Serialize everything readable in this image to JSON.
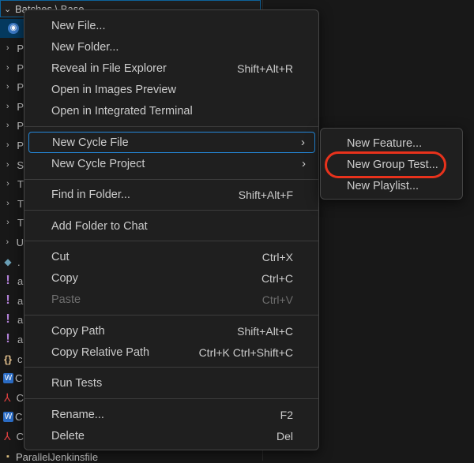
{
  "explorer": {
    "header_title": "Batches \\ Base",
    "tree_rows": [
      {
        "glyph": "›",
        "kind": "chev",
        "letter": "P"
      },
      {
        "glyph": "›",
        "kind": "chev",
        "letter": "P"
      },
      {
        "glyph": "›",
        "kind": "chev",
        "letter": "P"
      },
      {
        "glyph": "›",
        "kind": "chev",
        "letter": "P"
      },
      {
        "glyph": "›",
        "kind": "chev",
        "letter": "P"
      },
      {
        "glyph": "›",
        "kind": "chev",
        "letter": "P"
      },
      {
        "glyph": "›",
        "kind": "chev",
        "letter": "S"
      },
      {
        "glyph": "›",
        "kind": "chev",
        "letter": "T"
      },
      {
        "glyph": "›",
        "kind": "chev",
        "letter": "T"
      },
      {
        "glyph": "›",
        "kind": "chev",
        "letter": "T"
      },
      {
        "glyph": "›",
        "kind": "chev",
        "letter": "U"
      },
      {
        "glyph": "◆",
        "kind": "diamond",
        "letter": "."
      },
      {
        "glyph": "!",
        "kind": "excl",
        "letter": "a"
      },
      {
        "glyph": "!",
        "kind": "excl",
        "letter": "a"
      },
      {
        "glyph": "!",
        "kind": "excl",
        "letter": "a"
      },
      {
        "glyph": "!",
        "kind": "excl",
        "letter": "a"
      },
      {
        "glyph": "{}",
        "kind": "brace",
        "letter": "c"
      },
      {
        "glyph": "W",
        "kind": "word",
        "letter": "C"
      },
      {
        "glyph": "⅄",
        "kind": "pdf",
        "letter": "C"
      },
      {
        "glyph": "W",
        "kind": "word",
        "letter": "C"
      },
      {
        "glyph": "⅄",
        "kind": "pdf",
        "letter": "C"
      }
    ],
    "footer_label": "ParallelJenkinsfile"
  },
  "context_menu": {
    "items": [
      {
        "id": "new-file",
        "label": "New File...",
        "shortcut": ""
      },
      {
        "id": "new-folder",
        "label": "New Folder...",
        "shortcut": ""
      },
      {
        "id": "reveal",
        "label": "Reveal in File Explorer",
        "shortcut": "Shift+Alt+R"
      },
      {
        "id": "open-images-preview",
        "label": "Open in Images Preview",
        "shortcut": ""
      },
      {
        "id": "open-terminal",
        "label": "Open in Integrated Terminal",
        "shortcut": ""
      },
      {
        "id": "new-cycle-file",
        "label": "New Cycle File",
        "shortcut": "",
        "submenu": true
      },
      {
        "id": "new-cycle-project",
        "label": "New Cycle Project",
        "shortcut": "",
        "submenu": true
      },
      {
        "id": "find-in-folder",
        "label": "Find in Folder...",
        "shortcut": "Shift+Alt+F"
      },
      {
        "id": "add-folder-to-chat",
        "label": "Add Folder to Chat",
        "shortcut": ""
      },
      {
        "id": "cut",
        "label": "Cut",
        "shortcut": "Ctrl+X"
      },
      {
        "id": "copy",
        "label": "Copy",
        "shortcut": "Ctrl+C"
      },
      {
        "id": "paste",
        "label": "Paste",
        "shortcut": "Ctrl+V",
        "disabled": true
      },
      {
        "id": "copy-path",
        "label": "Copy Path",
        "shortcut": "Shift+Alt+C"
      },
      {
        "id": "copy-relative-path",
        "label": "Copy Relative Path",
        "shortcut": "Ctrl+K Ctrl+Shift+C"
      },
      {
        "id": "run-tests",
        "label": "Run Tests",
        "shortcut": ""
      },
      {
        "id": "rename",
        "label": "Rename...",
        "shortcut": "F2"
      },
      {
        "id": "delete",
        "label": "Delete",
        "shortcut": "Del"
      }
    ],
    "submenu_arrow": "›"
  },
  "submenu": {
    "items": [
      {
        "id": "new-feature",
        "label": "New Feature..."
      },
      {
        "id": "new-group-test",
        "label": "New Group Test..."
      },
      {
        "id": "new-playlist",
        "label": "New Playlist..."
      }
    ]
  },
  "colors": {
    "background": "#181818",
    "menu_bg": "#1f1f1f",
    "focus_border": "#2489db",
    "annotation_ring": "#e8321c",
    "selection": "#04395e"
  }
}
